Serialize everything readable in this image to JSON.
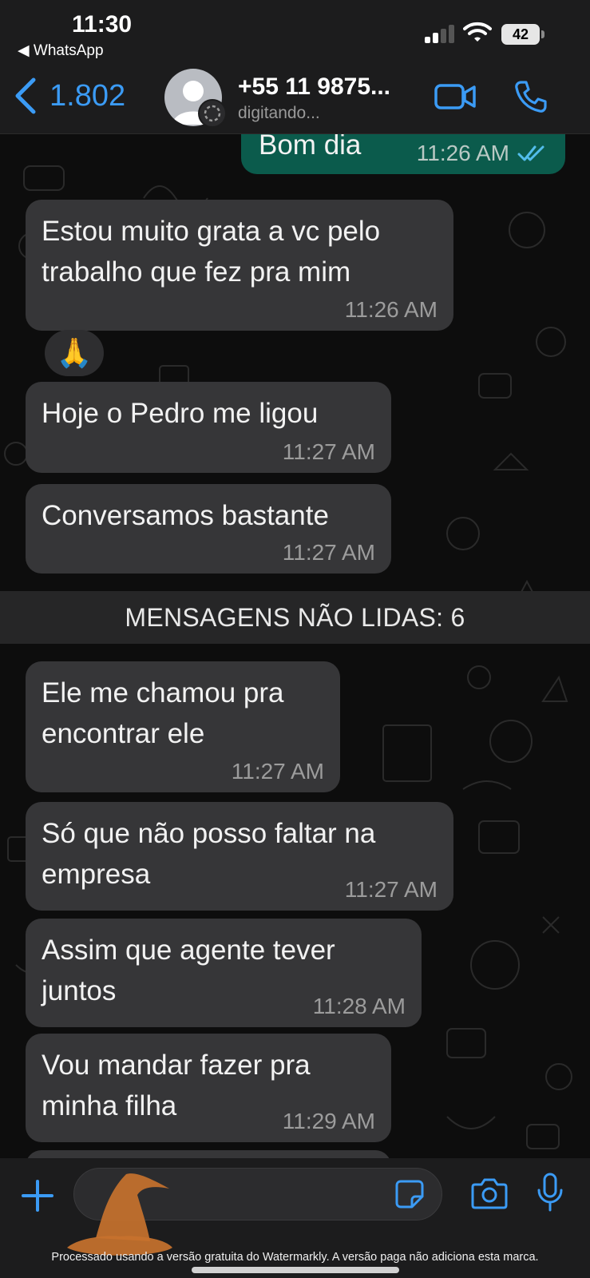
{
  "status_bar": {
    "time": "11:30",
    "back_app": "◀ WhatsApp",
    "battery": "42"
  },
  "header": {
    "back_count": "1.802",
    "contact_name": "+55 11 9875...",
    "contact_status": "digitando...",
    "accent_color": "#3b9bf5"
  },
  "messages": [
    {
      "direction": "out",
      "text": "Bom dia",
      "time": "11:26 AM",
      "read": true
    },
    {
      "direction": "in",
      "text": "Estou muito grata a vc pelo trabalho que fez pra mim",
      "time": "11:26 AM"
    },
    {
      "direction": "in",
      "text": "🙏",
      "type": "emoji"
    },
    {
      "direction": "in",
      "text": "Hoje o Pedro me ligou",
      "time": "11:27 AM"
    },
    {
      "direction": "in",
      "text": "Conversamos bastante",
      "time": "11:27 AM"
    },
    {
      "direction": "in",
      "text": "Ele me chamou pra encontrar ele",
      "time": "11:27 AM"
    },
    {
      "direction": "in",
      "text": "Só que não posso faltar na empresa",
      "time": "11:27 AM"
    },
    {
      "direction": "in",
      "text": "Assim que agente tever juntos",
      "time": "11:28 AM"
    },
    {
      "direction": "in",
      "text": "Vou mandar fazer pra minha filha",
      "time": "11:29 AM"
    }
  ],
  "unread_divider": "MENSAGENS NÃO LIDAS: 6",
  "input": {
    "placeholder": ""
  },
  "watermark": "Processado usando a versão gratuita do Watermarkly. A versão paga não adiciona esta marca.",
  "icons": [
    "back-chevron-icon",
    "video-call-icon",
    "phone-icon",
    "plus-icon",
    "sticker-icon",
    "camera-icon",
    "mic-icon",
    "double-check-icon",
    "wizard-hat-icon"
  ],
  "colors": {
    "incoming_bubble": "#363638",
    "outgoing_bubble": "#0b5b4c",
    "accent": "#3b9bf5"
  }
}
